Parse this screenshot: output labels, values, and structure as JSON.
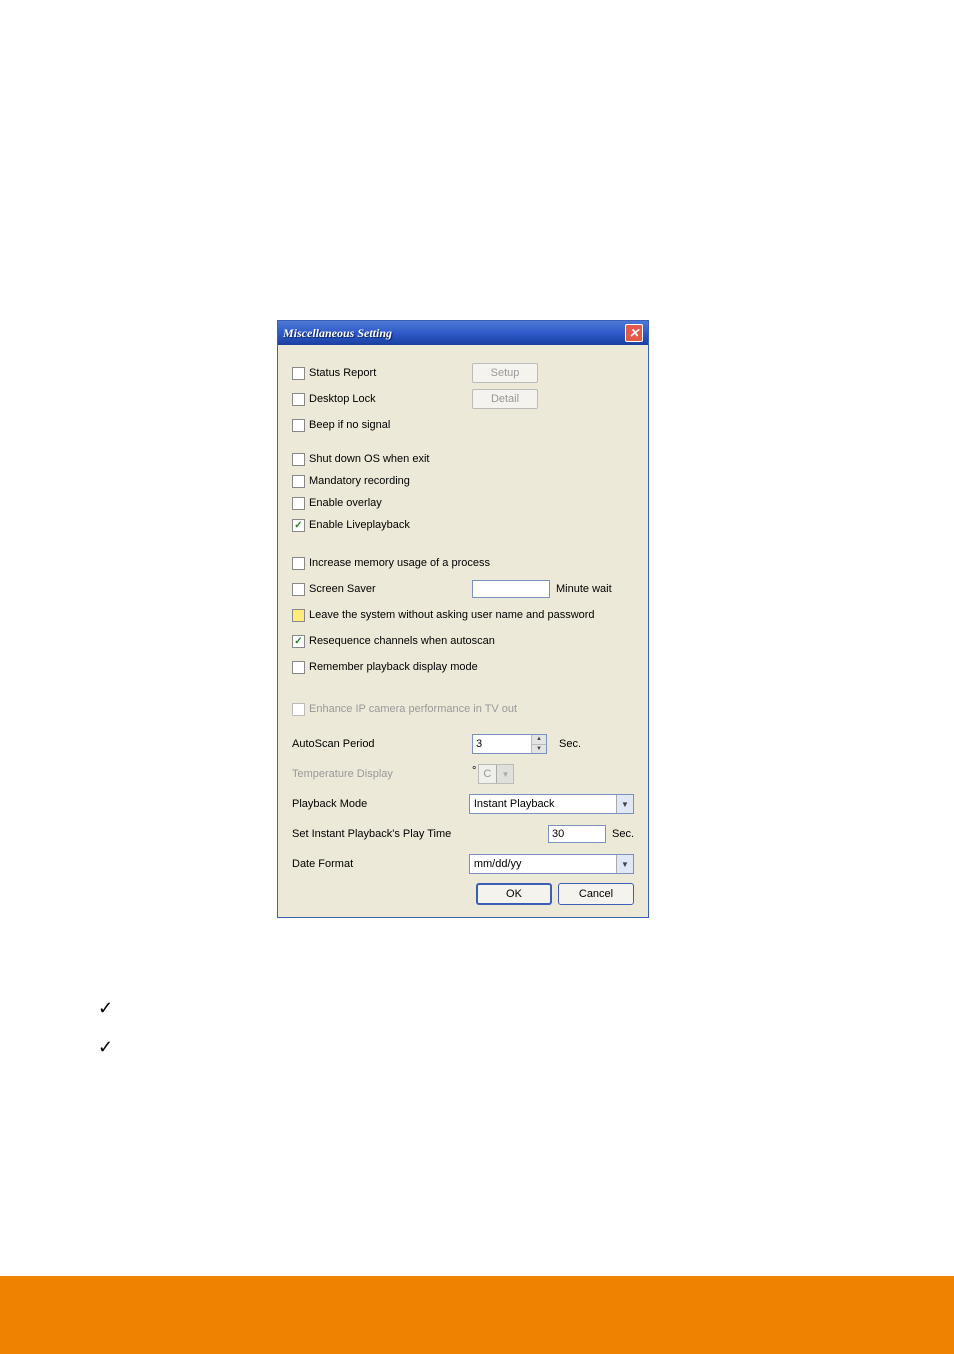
{
  "dialog": {
    "title": "Miscellaneous Setting",
    "close_symbol": "✕",
    "checkboxes": {
      "status_report": "Status Report",
      "desktop_lock": "Desktop Lock",
      "beep_no_signal": "Beep if no signal",
      "shutdown_os": "Shut down OS when exit",
      "mandatory_recording": "Mandatory recording",
      "enable_overlay": "Enable overlay",
      "enable_liveplayback": "Enable Liveplayback",
      "increase_memory": "Increase memory usage of a process",
      "screen_saver": "Screen Saver",
      "leave_system": "Leave the system without asking user name and password",
      "resequence": "Resequence channels when autoscan",
      "remember_playback": "Remember playback display mode",
      "enhance_ip": "Enhance IP camera performance in TV out"
    },
    "buttons": {
      "setup": "Setup",
      "detail": "Detail",
      "ok": "OK",
      "cancel": "Cancel"
    },
    "labels": {
      "minute_wait": "Minute wait",
      "autoscan_period": "AutoScan Period",
      "temperature_display": "Temperature Display",
      "playback_mode": "Playback Mode",
      "set_instant_playtime": "Set Instant Playback's Play Time",
      "date_format": "Date Format",
      "sec": "Sec.",
      "degree": "°"
    },
    "values": {
      "autoscan_period": "3",
      "temp_unit": "C",
      "playback_mode": "Instant Playback",
      "instant_playtime": "30",
      "date_format": "mm/dd/yy",
      "screen_saver_minutes": ""
    }
  },
  "page": {
    "checkmark": "✓"
  }
}
